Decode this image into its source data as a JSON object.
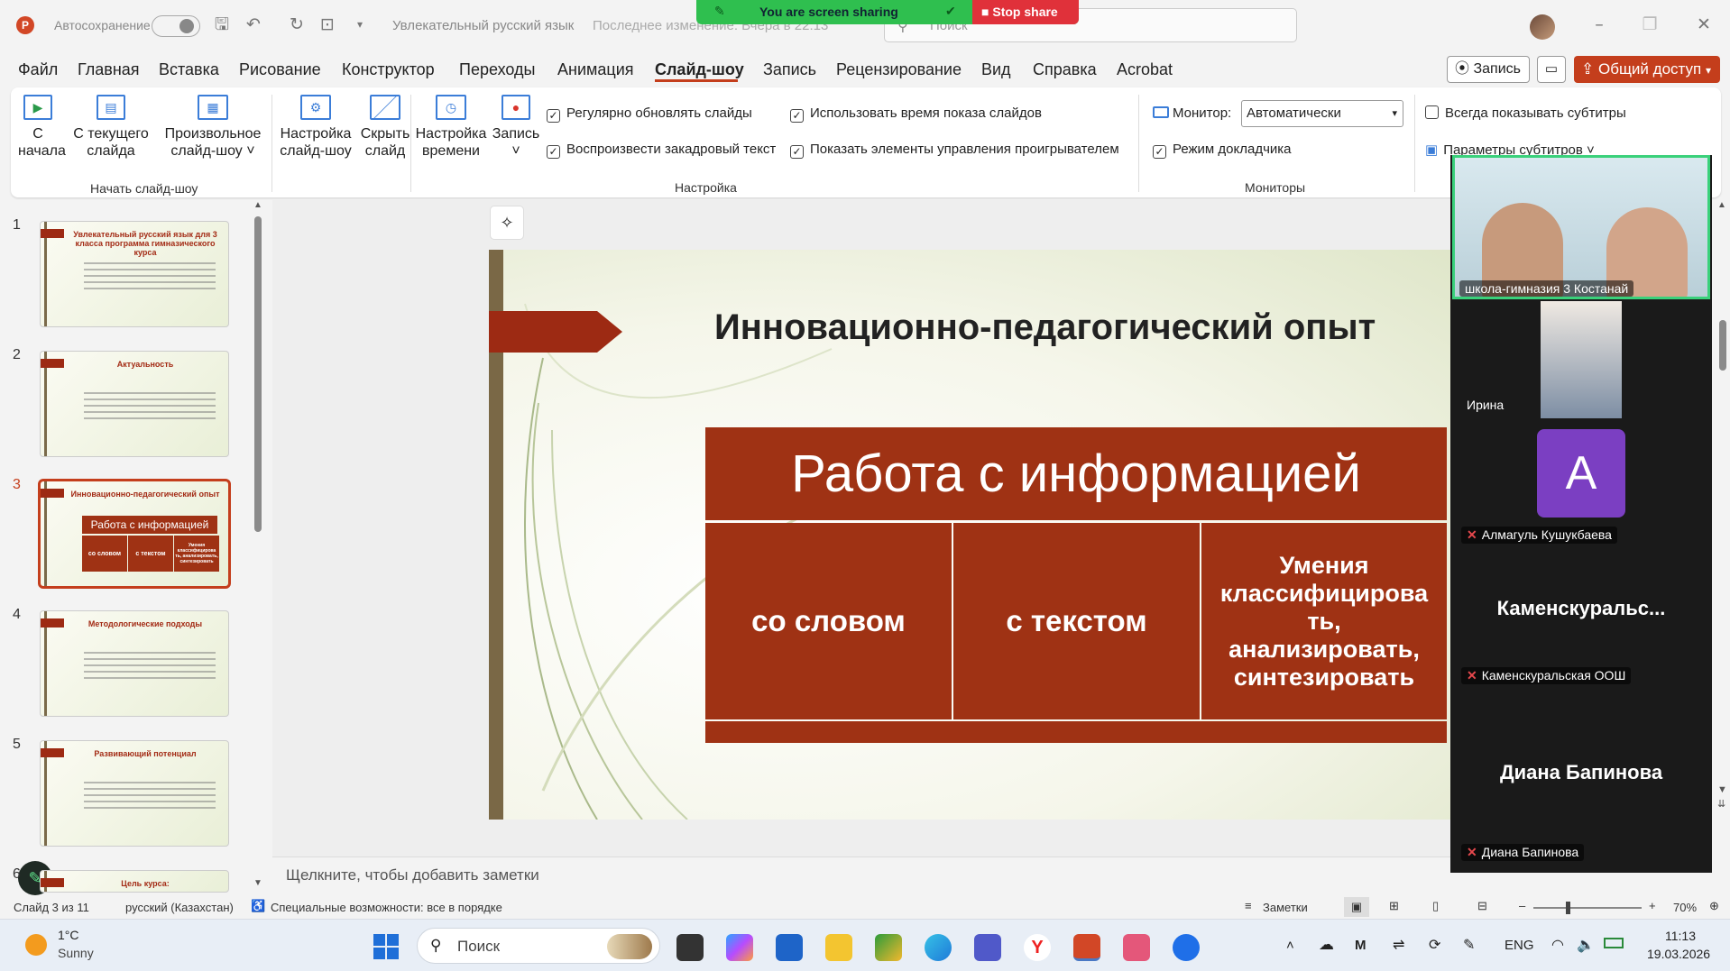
{
  "app": {
    "autosave_label": "Автосохранение",
    "doc_title": "Увлекательный русский язык",
    "last_modified": "Последнее изменение: Вчера в 22:13",
    "search_placeholder": "Поиск",
    "record_button": "Запись",
    "share_button": "Общий доступ"
  },
  "screen_share": {
    "status": "You are screen sharing",
    "stop_label": "Stop share"
  },
  "menu": [
    "Файл",
    "Главная",
    "Вставка",
    "Рисование",
    "Конструктор",
    "Переходы",
    "Анимация",
    "Слайд-шоу",
    "Запись",
    "Рецензирование",
    "Вид",
    "Справка",
    "Acrobat"
  ],
  "active_menu": "Слайд-шоу",
  "ribbon": {
    "start_group": "Начать слайд-шоу",
    "setup_group": "Настройка",
    "monitors_group": "Мониторы",
    "btn_from_start": [
      "С",
      "начала"
    ],
    "btn_from_current": [
      "С текущего",
      "слайда"
    ],
    "btn_custom": [
      "Произвольное",
      "слайд-шоу ˅"
    ],
    "btn_setup": [
      "Настройка",
      "слайд-шоу"
    ],
    "btn_hide": [
      "Скрыть",
      "слайд"
    ],
    "btn_timing": [
      "Настройка",
      "времени"
    ],
    "btn_record": [
      "Запись",
      "˅"
    ],
    "chk_update": "Регулярно обновлять слайды",
    "chk_narration": "Воспроизвести закадровый текст",
    "chk_timings": "Использовать время показа слайдов",
    "chk_media": "Показать элементы управления проигрывателем",
    "monitor_label": "Монитор:",
    "monitor_value": "Автоматически",
    "chk_presenter": "Режим докладчика",
    "chk_subtitles": "Всегда показывать субтитры",
    "subtitle_settings": "Параметры субтитров ˅"
  },
  "thumbnails": [
    {
      "num": "1",
      "title": "Увлекательный русский язык для 3 класса программа гимназического курса"
    },
    {
      "num": "2",
      "title": "Актуальность"
    },
    {
      "num": "3",
      "title": "Инновационно-педагогический опыт"
    },
    {
      "num": "4",
      "title": "Методологические подходы"
    },
    {
      "num": "5",
      "title": "Развивающий потенциал"
    },
    {
      "num": "6",
      "title": "Цель курса:"
    }
  ],
  "thumb3": {
    "banner": "Работа с информацией",
    "c1": "со словом",
    "c2": "с текстом",
    "c3": "Умения классифицирова ть, анализировать, синтезировать"
  },
  "slide": {
    "title": "Инновационно-педагогический опыт",
    "banner": "Работа с информацией",
    "col1": "со словом",
    "col2": "с текстом",
    "col3": "Умения классифицирова ть, анализировать, синтезировать"
  },
  "notes_placeholder": "Щелкните, чтобы добавить заметки",
  "participants": [
    {
      "name": "школа-гимназия 3 Костанай"
    },
    {
      "name": "Ирина"
    },
    {
      "avatar": "А",
      "name": "Алмагуль Кушукбаева"
    },
    {
      "big": "Каменскуральс...",
      "name": "Каменскуральская ООШ"
    },
    {
      "big": "Диана Бапинова",
      "name": "Диана Бапинова"
    }
  ],
  "status": {
    "slide": "Слайд 3 из 11",
    "language": "русский (Казахстан)",
    "accessibility": "Специальные возможности: все в порядке",
    "notes": "Заметки",
    "zoom": "70%"
  },
  "taskbar": {
    "temp": "1°C",
    "weather": "Sunny",
    "search": "Поиск",
    "lang": "ENG",
    "time": "11:13",
    "date": "19.03.2026"
  }
}
